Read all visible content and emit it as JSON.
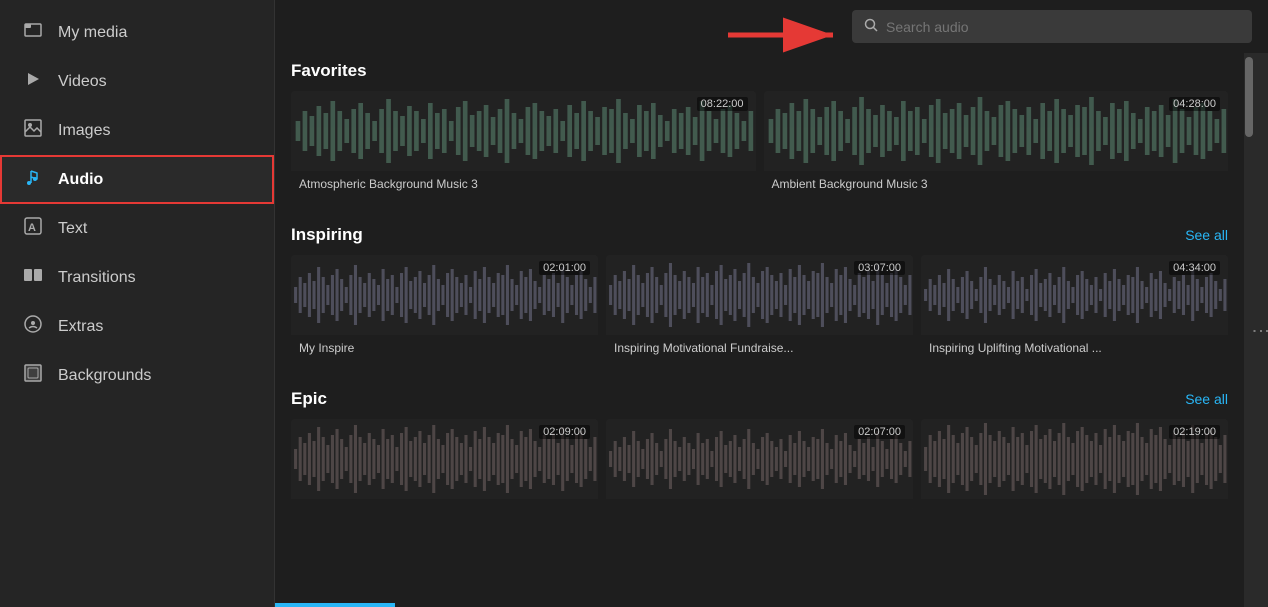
{
  "sidebar": {
    "items": [
      {
        "id": "my-media",
        "label": "My media",
        "icon": "🗂",
        "active": false
      },
      {
        "id": "videos",
        "label": "Videos",
        "icon": "▶",
        "active": false
      },
      {
        "id": "images",
        "label": "Images",
        "icon": "🖼",
        "active": false
      },
      {
        "id": "audio",
        "label": "Audio",
        "icon": "♪",
        "active": true
      },
      {
        "id": "text",
        "label": "Text",
        "icon": "🅰",
        "active": false
      },
      {
        "id": "transitions",
        "label": "Transitions",
        "icon": "⬛",
        "active": false
      },
      {
        "id": "extras",
        "label": "Extras",
        "icon": "☺",
        "active": false
      },
      {
        "id": "backgrounds",
        "label": "Backgrounds",
        "icon": "🖼",
        "active": false
      }
    ]
  },
  "search": {
    "placeholder": "Search audio"
  },
  "sections": {
    "favorites": {
      "title": "Favorites",
      "show_see_all": false,
      "tracks": [
        {
          "id": "fav1",
          "label": "Atmospheric Background Music 3",
          "duration": "08:22:00"
        },
        {
          "id": "fav2",
          "label": "Ambient Background Music 3",
          "duration": "04:28:00"
        }
      ]
    },
    "inspiring": {
      "title": "Inspiring",
      "see_all_label": "See all",
      "tracks": [
        {
          "id": "ins1",
          "label": "My Inspire",
          "duration": "02:01:00"
        },
        {
          "id": "ins2",
          "label": "Inspiring Motivational Fundraise...",
          "duration": "03:07:00"
        },
        {
          "id": "ins3",
          "label": "Inspiring Uplifting Motivational ...",
          "duration": "04:34:00"
        }
      ]
    },
    "epic": {
      "title": "Epic",
      "see_all_label": "See all",
      "tracks": [
        {
          "id": "ep1",
          "label": "",
          "duration": "02:09:00"
        },
        {
          "id": "ep2",
          "label": "",
          "duration": "02:07:00"
        },
        {
          "id": "ep3",
          "label": "",
          "duration": "02:19:00"
        }
      ]
    }
  },
  "colors": {
    "accent_blue": "#29b6f6",
    "accent_red": "#e53935",
    "sidebar_bg": "#252525",
    "card_bg": "#2a2a2a",
    "main_bg": "#1e1e1e"
  }
}
